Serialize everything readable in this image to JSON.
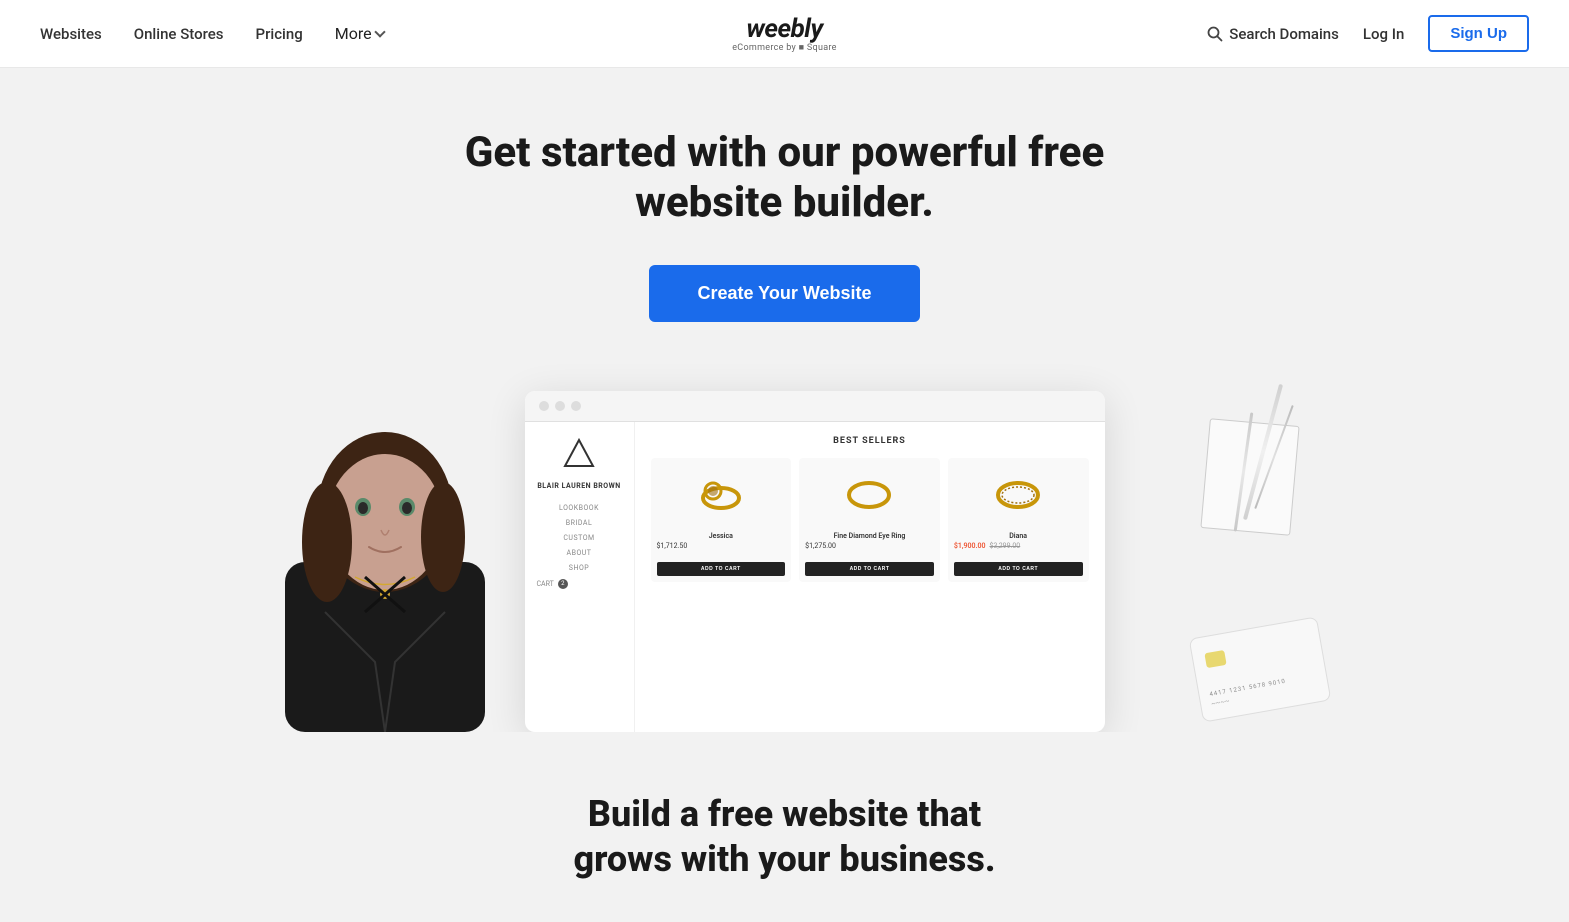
{
  "nav": {
    "links": [
      {
        "label": "Websites",
        "id": "websites"
      },
      {
        "label": "Online Stores",
        "id": "online-stores"
      },
      {
        "label": "Pricing",
        "id": "pricing"
      },
      {
        "label": "More",
        "id": "more",
        "hasDropdown": true
      }
    ],
    "logo": {
      "wordmark": "weebly",
      "sub": "eCommerce by ■ Square"
    },
    "searchDomains": "Search Domains",
    "login": "Log In",
    "signup": "Sign Up"
  },
  "hero": {
    "headline": "Get started with our powerful free website builder.",
    "cta": "Create Your Website"
  },
  "shop": {
    "brand": "BLAIR LAUREN BROWN",
    "navItems": [
      "LOOKBOOK",
      "BRIDAL",
      "CUSTOM",
      "ABOUT",
      "SHOP"
    ],
    "cart": "CART",
    "cartCount": "2",
    "sectionTitle": "BEST SELLERS",
    "products": [
      {
        "name": "Jessica",
        "price": "$1,712.50",
        "emoji": "💍"
      },
      {
        "name": "Fine Diamond Eye Ring",
        "price": "$1,275.00",
        "emoji": "💍"
      },
      {
        "name": "Diana",
        "priceOriginal": "$3,299.00",
        "priceSale": "$1,900.00",
        "emoji": "💍"
      }
    ]
  },
  "bottom": {
    "headline1": "Build a free website that",
    "headline2": "grows with your business."
  }
}
